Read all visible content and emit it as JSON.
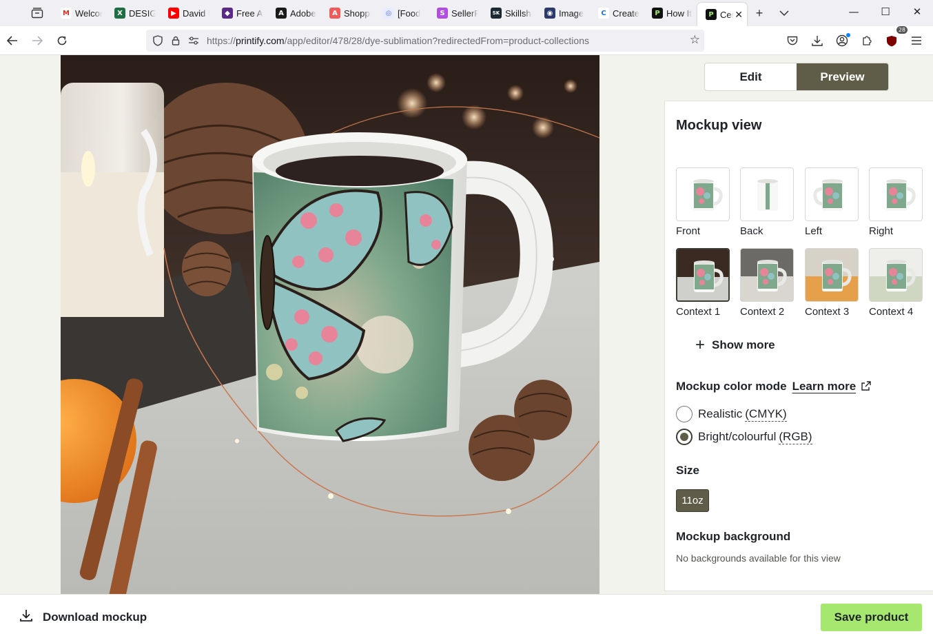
{
  "browser": {
    "tabs": [
      {
        "title": "Welcome",
        "favicon_color": "#ffffff",
        "favicon_glyph": "M",
        "glyph_color": "#d93025"
      },
      {
        "title": "DESIGN",
        "favicon_color": "#1d6f42",
        "favicon_glyph": "X",
        "glyph_color": "#ffffff"
      },
      {
        "title": "David L",
        "favicon_color": "#ff0000",
        "favicon_glyph": "▶",
        "glyph_color": "#ffffff"
      },
      {
        "title": "Free AI",
        "favicon_color": "#5b2a86",
        "favicon_glyph": "◆",
        "glyph_color": "#ffffff"
      },
      {
        "title": "Adobe",
        "favicon_color": "#1a1a1a",
        "favicon_glyph": "A",
        "glyph_color": "#ffffff"
      },
      {
        "title": "Shopping",
        "favicon_color": "#ef5a5a",
        "favicon_glyph": "A",
        "glyph_color": "#ffffff"
      },
      {
        "title": "[Food",
        "favicon_color": "#e7ecff",
        "favicon_glyph": "◎",
        "glyph_color": "#5b6cff"
      },
      {
        "title": "SellerPic",
        "favicon_color": "#b34ce0",
        "favicon_glyph": "S",
        "glyph_color": "#ffffff"
      },
      {
        "title": "Skillshare",
        "favicon_color": "#1a2a33",
        "favicon_glyph": "SK",
        "glyph_color": "#ffffff"
      },
      {
        "title": "Image",
        "favicon_color": "#2a3a6a",
        "favicon_glyph": "◉",
        "glyph_color": "#ffffff"
      },
      {
        "title": "Create",
        "favicon_color": "#ffffff",
        "favicon_glyph": "C",
        "glyph_color": "#1a73e8"
      },
      {
        "title": "How It",
        "favicon_color": "#111111",
        "favicon_glyph": "P",
        "glyph_color": "#a6e86f"
      },
      {
        "title": "Ceramic",
        "favicon_color": "#111111",
        "favicon_glyph": "P",
        "glyph_color": "#a6e86f",
        "active": true
      }
    ],
    "url_prefix": "https://",
    "url_domain": "printify.com",
    "url_path": "/app/editor/478/28/dye-sublimation?redirectedFrom=product-collections",
    "extension_badge": "28"
  },
  "editor": {
    "view_toggle": {
      "edit": "Edit",
      "preview": "Preview",
      "active": "preview"
    },
    "mockup_view_title": "Mockup view",
    "views": [
      {
        "label": "Front",
        "kind": "plain"
      },
      {
        "label": "Back",
        "kind": "plain"
      },
      {
        "label": "Left",
        "kind": "plain"
      },
      {
        "label": "Right",
        "kind": "plain"
      },
      {
        "label": "Context 1",
        "kind": "context",
        "selected": true
      },
      {
        "label": "Context 2",
        "kind": "context"
      },
      {
        "label": "Context 3",
        "kind": "context"
      },
      {
        "label": "Context 4",
        "kind": "context"
      }
    ],
    "show_more": "Show more",
    "color_mode": {
      "title": "Mockup color mode",
      "learn_more": "Learn more",
      "options": [
        {
          "label": "Realistic",
          "code": "(CMYK)",
          "checked": false
        },
        {
          "label": "Bright/colourful",
          "code": "(RGB)",
          "checked": true
        }
      ]
    },
    "size": {
      "title": "Size",
      "value": "11oz"
    },
    "background": {
      "title": "Mockup background",
      "note": "No backgrounds available for this view"
    },
    "download_label": "Download mockup",
    "save_label": "Save product"
  },
  "colors": {
    "accent_dark": "#5f5d48",
    "save_green": "#a6e86f",
    "mug_print_green": "#7fa88c"
  }
}
